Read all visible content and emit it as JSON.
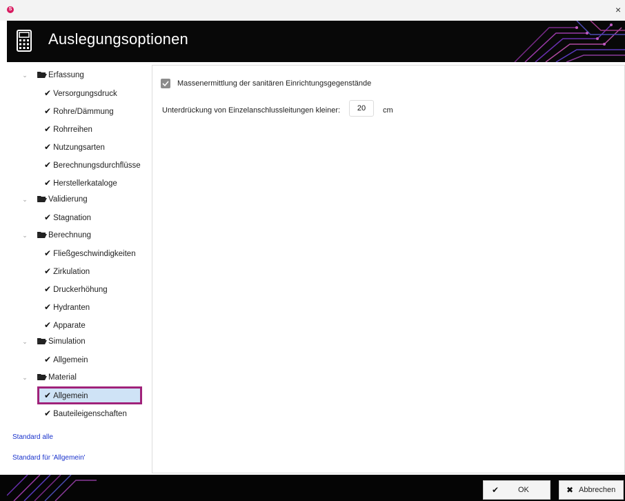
{
  "window": {
    "app_icon_letter": "S",
    "close_glyph": "×"
  },
  "header": {
    "title": "Auslegungsoptionen",
    "icon": "calculator-icon"
  },
  "tree": {
    "groups": [
      {
        "label": "Erfassung",
        "items": [
          "Versorgungsdruck",
          "Rohre/Dämmung",
          "Rohrreihen",
          "Nutzungsarten",
          "Berechnungsdurchflüsse",
          "Herstellerkataloge"
        ]
      },
      {
        "label": "Validierung",
        "items": [
          "Stagnation"
        ]
      },
      {
        "label": "Berechnung",
        "items": [
          "Fließgeschwindigkeiten",
          "Zirkulation",
          "Druckerhöhung",
          "Hydranten",
          "Apparate"
        ]
      },
      {
        "label": "Simulation",
        "items": [
          "Allgemein"
        ]
      },
      {
        "label": "Material",
        "items": [
          "Allgemein",
          "Bauteileigenschaften"
        ]
      }
    ],
    "selected_item": "Material / Allgemein"
  },
  "links": {
    "standard_all": "Standard alle",
    "standard_current": "Standard für 'Allgemein'"
  },
  "content": {
    "checkbox_label": "Massenermittlung der sanitären Einrichtungsgegenstände",
    "checkbox_checked": true,
    "field_label": "Unterdrückung von Einzelanschlussleitungen kleiner:",
    "field_value": "20",
    "field_unit": "cm"
  },
  "footer": {
    "ok_label": "OK",
    "cancel_label": "Abbrechen"
  },
  "colors": {
    "accent_magenta": "#a0227a",
    "selection_bg": "#cfe3f6",
    "link": "#1a33cc",
    "banner_bg": "#080808"
  }
}
